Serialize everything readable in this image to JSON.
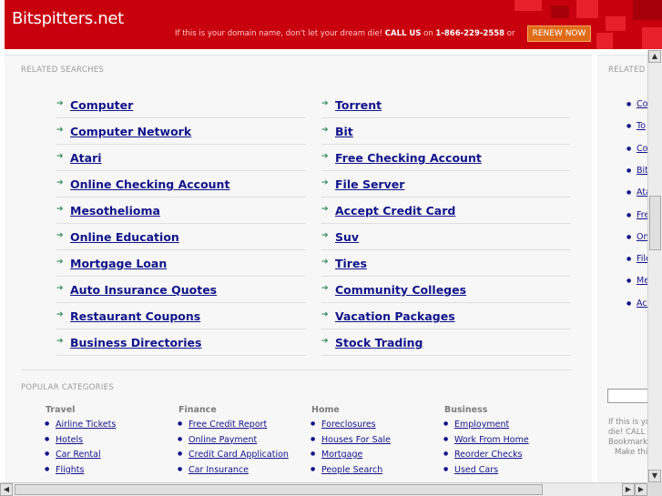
{
  "header": {
    "site_name": "Bitspitters.net",
    "banner_text": "If this is your domain name, don't let your dream die!",
    "call_us": "CALL US",
    "on": "on",
    "phone": "1-866-229-2558",
    "or": "or",
    "renew_label": "RENEW NOW",
    "colors": {
      "background": "#c8000d",
      "button": "#e06c1a"
    }
  },
  "related": {
    "title": "RELATED SEARCHES",
    "left": [
      "Computer",
      "Computer Network",
      "Atari",
      "Online Checking Account",
      "Mesothelioma",
      "Online Education",
      "Mortgage Loan",
      "Auto Insurance Quotes",
      "Restaurant Coupons",
      "Business Directories"
    ],
    "right": [
      "Torrent",
      "Bit",
      "Free Checking Account",
      "File Server",
      "Accept Credit Card",
      "Suv",
      "Tires",
      "Community Colleges",
      "Vacation Packages",
      "Stock Trading"
    ]
  },
  "popular": {
    "title": "POPULAR CATEGORIES",
    "columns": [
      {
        "heading": "Travel",
        "links": [
          "Airline Tickets",
          "Hotels",
          "Car Rental",
          "Flights"
        ]
      },
      {
        "heading": "Finance",
        "links": [
          "Free Credit Report",
          "Online Payment",
          "Credit Card Application",
          "Car Insurance"
        ]
      },
      {
        "heading": "Home",
        "links": [
          "Foreclosures",
          "Houses For Sale",
          "Mortgage",
          "People Search"
        ]
      },
      {
        "heading": "Business",
        "links": [
          "Employment",
          "Work From Home",
          "Reorder Checks",
          "Used Cars"
        ]
      }
    ]
  },
  "sidebar": {
    "title": "RELATED",
    "links": [
      "Co",
      "To",
      "Co",
      "Bit",
      "Ata",
      "Fre",
      "On",
      "File",
      "Me",
      "Acc"
    ],
    "note_lines": [
      "If this is yo",
      "die! CALL",
      "Bookmark",
      "Make thi"
    ]
  }
}
